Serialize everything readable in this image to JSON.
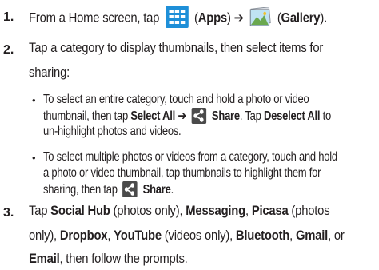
{
  "steps": [
    {
      "number": "1.",
      "lines": [
        {
          "t1": "From a Home screen, tap",
          "apps_icon": "apps-icon",
          "t2": "(",
          "b1": "Apps",
          "t3": ") ➔",
          "gallery_icon": "gallery-icon",
          "t4": "(",
          "b2": "Gallery",
          "t5": ")."
        }
      ]
    },
    {
      "number": "2.",
      "lines": [
        "Tap a category to display thumbnails, then select items for",
        "sharing:"
      ],
      "bullets": [
        {
          "l1": "To select an entire category, touch and hold a photo or video",
          "l2_a": "thumbnail, then tap ",
          "l2_b1": "Select All",
          "l2_b": " ➔",
          "l2_share": "Share",
          "l2_c": ". Tap ",
          "l2_b2": "Deselect All",
          "l2_d": " to",
          "l3": "un-highlight photos and videos."
        },
        {
          "l1": "To select multiple photos or videos from a category, touch and hold",
          "l2": "a photo or video thumbnail, tap thumbnails to highlight them for",
          "l3_a": "sharing, then tap",
          "l3_share": "Share",
          "l3_b": "."
        }
      ]
    },
    {
      "number": "3.",
      "line1": {
        "a": "Tap ",
        "b1": "Social Hub",
        "c": " (photos only), ",
        "b2": "Messaging",
        "d": ", ",
        "b3": "Picasa",
        "e": " (photos"
      },
      "line2": {
        "a": "only), ",
        "b1": "Dropbox",
        "c": ", ",
        "b2": "YouTube",
        "d": " (videos only), ",
        "b3": "Bluetooth",
        "e": ", ",
        "b4": "Gmail",
        "f": ", or"
      },
      "line3": {
        "b1": "Email",
        "a": ", then follow the prompts."
      }
    }
  ],
  "colors": {
    "text": "#231f20",
    "apps_icon_bg": "#1e8fd8",
    "share_icon_bg": "#4a4a4a"
  }
}
